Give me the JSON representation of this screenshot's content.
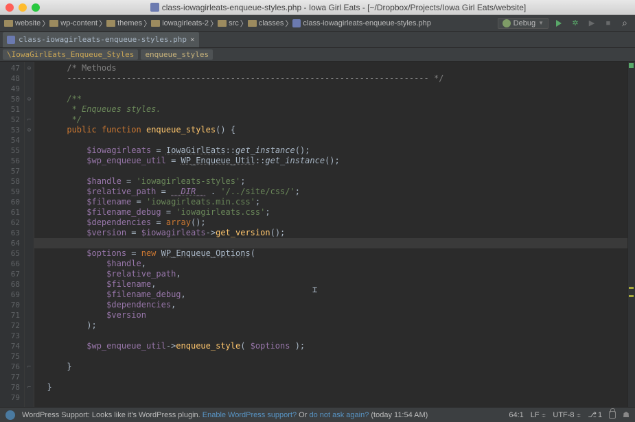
{
  "window": {
    "title": "class-iowagirleats-enqueue-styles.php - Iowa Girl Eats - [~/Dropbox/Projects/Iowa Girl Eats/website]"
  },
  "breadcrumbs": [
    {
      "icon": "folder",
      "label": "website"
    },
    {
      "icon": "folder",
      "label": "wp-content"
    },
    {
      "icon": "folder",
      "label": "themes"
    },
    {
      "icon": "folder",
      "label": "iowagirleats-2"
    },
    {
      "icon": "folder",
      "label": "src"
    },
    {
      "icon": "folder",
      "label": "classes"
    },
    {
      "icon": "php",
      "label": "class-iowagirleats-enqueue-styles.php"
    }
  ],
  "debug_combo": "Debug",
  "tab": {
    "label": "class-iowagirleats-enqueue-styles.php"
  },
  "context_breadcrumb": {
    "class": "\\IowaGirlEats_Enqueue_Styles",
    "method": "enqueue_styles"
  },
  "gutter_start": 47,
  "gutter_end": 79,
  "code_lines": {
    "47": {
      "indent": "      ",
      "tokens": [
        {
          "t": "/* Methods",
          "c": "c-comment"
        }
      ]
    },
    "48": {
      "indent": "      ",
      "tokens": [
        {
          "t": "------------------------------------------------------------------------- */",
          "c": "c-comment"
        }
      ]
    },
    "49": {
      "indent": "",
      "tokens": []
    },
    "50": {
      "indent": "      ",
      "tokens": [
        {
          "t": "/**",
          "c": "c-doccom"
        }
      ]
    },
    "51": {
      "indent": "       ",
      "tokens": [
        {
          "t": "* ",
          "c": "c-doccom"
        },
        {
          "t": "Enqueues styles.",
          "c": "c-doccom"
        }
      ]
    },
    "52": {
      "indent": "       ",
      "tokens": [
        {
          "t": "*/",
          "c": "c-doccom"
        }
      ]
    },
    "53": {
      "indent": "      ",
      "tokens": [
        {
          "t": "public ",
          "c": "c-keyword"
        },
        {
          "t": "function ",
          "c": "c-keyword"
        },
        {
          "t": "enqueue_styles",
          "c": "c-func"
        },
        {
          "t": "() {",
          "c": "c-paren"
        }
      ]
    },
    "54": {
      "indent": "",
      "tokens": []
    },
    "55": {
      "indent": "          ",
      "tokens": [
        {
          "t": "$iowagirleats",
          "c": "c-var"
        },
        {
          "t": " = ",
          "c": ""
        },
        {
          "t": "IowaGirlEats",
          "c": "c-class und"
        },
        {
          "t": "::",
          "c": ""
        },
        {
          "t": "get_instance",
          "c": "c-static"
        },
        {
          "t": "();",
          "c": "c-paren"
        }
      ]
    },
    "56": {
      "indent": "          ",
      "tokens": [
        {
          "t": "$wp_enqueue_util",
          "c": "c-var"
        },
        {
          "t": " = ",
          "c": ""
        },
        {
          "t": "WP_Enqueue_Util",
          "c": "c-class und"
        },
        {
          "t": "::",
          "c": ""
        },
        {
          "t": "get_instance",
          "c": "c-static"
        },
        {
          "t": "();",
          "c": "c-paren"
        }
      ]
    },
    "57": {
      "indent": "",
      "tokens": []
    },
    "58": {
      "indent": "          ",
      "tokens": [
        {
          "t": "$handle",
          "c": "c-var"
        },
        {
          "t": " = ",
          "c": ""
        },
        {
          "t": "'iowagirleats-styles'",
          "c": "c-string"
        },
        {
          "t": ";",
          "c": "c-paren"
        }
      ]
    },
    "59": {
      "indent": "          ",
      "tokens": [
        {
          "t": "$relative_path",
          "c": "c-var"
        },
        {
          "t": " = ",
          "c": ""
        },
        {
          "t": "__DIR__",
          "c": "c-const und"
        },
        {
          "t": " . ",
          "c": ""
        },
        {
          "t": "'/../site/css/'",
          "c": "c-string"
        },
        {
          "t": ";",
          "c": "c-paren"
        }
      ]
    },
    "60": {
      "indent": "          ",
      "tokens": [
        {
          "t": "$filename",
          "c": "c-var"
        },
        {
          "t": " = ",
          "c": ""
        },
        {
          "t": "'iowagirleats.min.css'",
          "c": "c-string"
        },
        {
          "t": ";",
          "c": "c-paren"
        }
      ]
    },
    "61": {
      "indent": "          ",
      "tokens": [
        {
          "t": "$filename_debug",
          "c": "c-var"
        },
        {
          "t": " = ",
          "c": ""
        },
        {
          "t": "'iowagirleats.css'",
          "c": "c-string"
        },
        {
          "t": ";",
          "c": "c-paren"
        }
      ]
    },
    "62": {
      "indent": "          ",
      "tokens": [
        {
          "t": "$dependencies",
          "c": "c-var"
        },
        {
          "t": " = ",
          "c": ""
        },
        {
          "t": "array",
          "c": "c-keyword"
        },
        {
          "t": "();",
          "c": "c-paren"
        }
      ]
    },
    "63": {
      "indent": "          ",
      "tokens": [
        {
          "t": "$version",
          "c": "c-var"
        },
        {
          "t": " = ",
          "c": ""
        },
        {
          "t": "$iowagirleats",
          "c": "c-var"
        },
        {
          "t": "->",
          "c": ""
        },
        {
          "t": "get_version",
          "c": "c-method"
        },
        {
          "t": "();",
          "c": "c-paren"
        }
      ]
    },
    "64": {
      "indent": "",
      "tokens": [],
      "caret": true
    },
    "65": {
      "indent": "          ",
      "tokens": [
        {
          "t": "$options",
          "c": "c-var"
        },
        {
          "t": " = ",
          "c": ""
        },
        {
          "t": "new ",
          "c": "c-keyword"
        },
        {
          "t": "WP_Enqueue_Options",
          "c": "c-class und"
        },
        {
          "t": "(",
          "c": "c-paren"
        }
      ]
    },
    "66": {
      "indent": "              ",
      "tokens": [
        {
          "t": "$handle",
          "c": "c-var"
        },
        {
          "t": ",",
          "c": "c-paren"
        }
      ]
    },
    "67": {
      "indent": "              ",
      "tokens": [
        {
          "t": "$relative_path",
          "c": "c-var"
        },
        {
          "t": ",",
          "c": "c-paren"
        }
      ]
    },
    "68": {
      "indent": "              ",
      "tokens": [
        {
          "t": "$filename",
          "c": "c-var"
        },
        {
          "t": ",",
          "c": "c-paren"
        }
      ]
    },
    "69": {
      "indent": "              ",
      "tokens": [
        {
          "t": "$filename_debug",
          "c": "c-var"
        },
        {
          "t": ",",
          "c": "c-paren"
        }
      ]
    },
    "70": {
      "indent": "              ",
      "tokens": [
        {
          "t": "$dependencies",
          "c": "c-var"
        },
        {
          "t": ",",
          "c": "c-paren"
        }
      ]
    },
    "71": {
      "indent": "              ",
      "tokens": [
        {
          "t": "$version",
          "c": "c-var"
        }
      ]
    },
    "72": {
      "indent": "          ",
      "tokens": [
        {
          "t": ");",
          "c": "c-paren"
        }
      ]
    },
    "73": {
      "indent": "",
      "tokens": []
    },
    "74": {
      "indent": "          ",
      "tokens": [
        {
          "t": "$wp_enqueue_util",
          "c": "c-var"
        },
        {
          "t": "->",
          "c": ""
        },
        {
          "t": "enqueue_style",
          "c": "c-method"
        },
        {
          "t": "( ",
          "c": "c-paren"
        },
        {
          "t": "$options",
          "c": "c-var"
        },
        {
          "t": " );",
          "c": "c-paren"
        }
      ]
    },
    "75": {
      "indent": "",
      "tokens": []
    },
    "76": {
      "indent": "      ",
      "tokens": [
        {
          "t": "}",
          "c": "c-paren"
        }
      ]
    },
    "77": {
      "indent": "",
      "tokens": []
    },
    "78": {
      "indent": "  ",
      "tokens": [
        {
          "t": "}",
          "c": "c-paren"
        }
      ]
    },
    "79": {
      "indent": "",
      "tokens": []
    }
  },
  "status": {
    "message_prefix": "WordPress Support: Looks like it's WordPress plugin. ",
    "link1": "Enable WordPress support?",
    "middle": " Or ",
    "link2": "do not ask again?",
    "timestamp": " (today 11:54 AM)",
    "pos": "64:1",
    "lf": "LF",
    "enc": "UTF-8",
    "branch": "1"
  }
}
